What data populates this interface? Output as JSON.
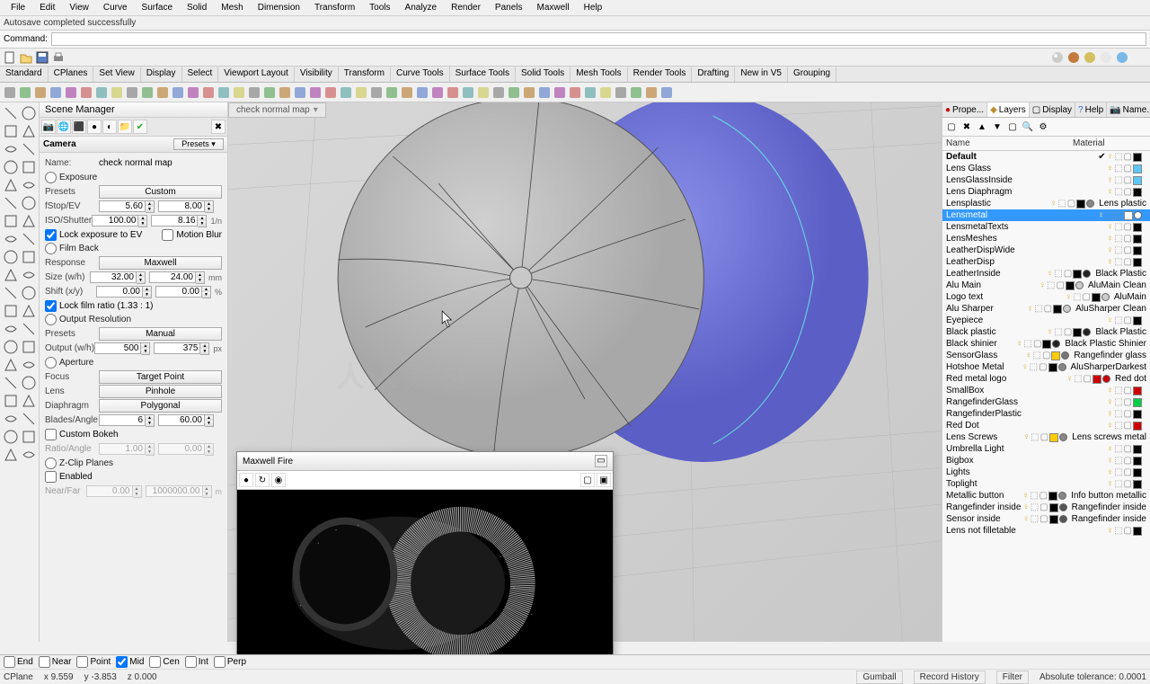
{
  "menu": [
    "File",
    "Edit",
    "View",
    "Curve",
    "Surface",
    "Solid",
    "Mesh",
    "Dimension",
    "Transform",
    "Tools",
    "Analyze",
    "Render",
    "Panels",
    "Maxwell",
    "Help"
  ],
  "autosave": "Autosave completed successfully",
  "command_label": "Command:",
  "tabstrip": [
    "Standard",
    "CPlanes",
    "Set View",
    "Display",
    "Select",
    "Viewport Layout",
    "Visibility",
    "Transform",
    "Curve Tools",
    "Surface Tools",
    "Solid Tools",
    "Mesh Tools",
    "Render Tools",
    "Drafting",
    "New in V5",
    "Grouping"
  ],
  "scene_mgr_title": "Scene Manager",
  "camera_label": "Camera",
  "presets_btn": "Presets ▾",
  "camera": {
    "name_label": "Name:",
    "name_value": "check normal map",
    "exposure": {
      "title": "Exposure",
      "presets_label": "Presets",
      "presets_btn": "Custom",
      "fstop_label": "fStop/EV",
      "fstop": "5.60",
      "ev": "8.00",
      "iso_label": "ISO/Shutter",
      "iso": "100.00",
      "shutter": "8.16",
      "shutter_unit": "1/n",
      "lock_exp": "Lock exposure to EV",
      "motion_blur": "Motion Blur"
    },
    "film": {
      "title": "Film Back",
      "response_label": "Response",
      "response_btn": "Maxwell",
      "size_label": "Size (w/h)",
      "size_w": "32.00",
      "size_h": "24.00",
      "size_unit": "mm",
      "shift_label": "Shift (x/y)",
      "shift_x": "0.00",
      "shift_y": "0.00",
      "shift_unit": "%",
      "lock_ratio": "Lock film ratio (1.33 : 1)"
    },
    "output": {
      "title": "Output Resolution",
      "presets_label": "Presets",
      "presets_btn": "Manual",
      "output_label": "Output (w/h)",
      "out_w": "500",
      "out_h": "375",
      "out_unit": "px"
    },
    "aperture": {
      "title": "Aperture",
      "focus_label": "Focus",
      "focus_btn": "Target Point",
      "lens_label": "Lens",
      "lens_btn": "Pinhole",
      "diaph_label": "Diaphragm",
      "diaph_btn": "Polygonal",
      "blades_label": "Blades/Angle",
      "blades": "6",
      "angle": "60.00",
      "bokeh": "Custom Bokeh",
      "ratio_label": "Ratio/Angle",
      "ratio": "1.00",
      "rangle": "0.00"
    },
    "zclip": {
      "title": "Z-Clip Planes",
      "enabled": "Enabled",
      "near_label": "Near/Far",
      "near": "0.00",
      "far": "1000000.00",
      "unit": "m"
    }
  },
  "viewport_title": "check normal map",
  "right_tabs": [
    {
      "icon": "●",
      "label": "Prope..."
    },
    {
      "icon": "◆",
      "label": "Layers"
    },
    {
      "icon": "▢",
      "label": "Display"
    },
    {
      "icon": "?",
      "label": "Help"
    },
    {
      "icon": "📷",
      "label": "Name..."
    }
  ],
  "layer_hdr": {
    "name": "Name",
    "material": "Material"
  },
  "layers": [
    {
      "name": "Default",
      "check": true,
      "color": "#000",
      "mat": ""
    },
    {
      "name": "Lens Glass",
      "color": "#5cc8f5",
      "mat": ""
    },
    {
      "name": "LensGlassInside",
      "color": "#5cc8f5",
      "mat": ""
    },
    {
      "name": "Lens Diaphragm",
      "color": "#000",
      "mat": ""
    },
    {
      "name": "Lensplastic",
      "color": "#000",
      "mat": "Lens plastic",
      "matdot": "#888"
    },
    {
      "name": "Lensmetal",
      "color": "#fff",
      "sel": true,
      "mat": "",
      "matdot": "#fff"
    },
    {
      "name": "LensmetalTexts",
      "color": "#000",
      "mat": ""
    },
    {
      "name": "LensMeshes",
      "color": "#000",
      "mat": ""
    },
    {
      "name": "LeatherDispWide",
      "color": "#000",
      "mat": ""
    },
    {
      "name": "LeatherDisp",
      "color": "#000",
      "mat": ""
    },
    {
      "name": "LeatherInside",
      "color": "#000",
      "mat": "Black Plastic",
      "matdot": "#222"
    },
    {
      "name": "Alu Main",
      "color": "#000",
      "mat": "AluMain Clean",
      "matdot": "#ccc"
    },
    {
      "name": "Logo text",
      "color": "#000",
      "mat": "AluMain",
      "matdot": "#ccc"
    },
    {
      "name": "Alu Sharper",
      "color": "#000",
      "mat": "AluSharper Clean",
      "matdot": "#ccc"
    },
    {
      "name": "Eyepiece",
      "color": "#000",
      "mat": ""
    },
    {
      "name": "Black plastic",
      "color": "#000",
      "mat": "Black Plastic",
      "matdot": "#222"
    },
    {
      "name": "Black shinier",
      "color": "#000",
      "mat": "Black Plastic Shinier",
      "matdot": "#222"
    },
    {
      "name": "SensorGlass",
      "color": "#ffcc00",
      "mat": "Rangefinder glass",
      "matdot": "#777"
    },
    {
      "name": "Hotshoe Metal",
      "color": "#000",
      "mat": "AluSharperDarkest",
      "matdot": "#888"
    },
    {
      "name": "Red metal logo",
      "color": "#cc0000",
      "mat": "Red dot",
      "matdot": "#cc0000"
    },
    {
      "name": "SmallBox",
      "color": "#cc0000",
      "mat": ""
    },
    {
      "name": "RangefinderGlass",
      "color": "#00cc44",
      "mat": ""
    },
    {
      "name": "RangefinderPlastic",
      "color": "#000",
      "mat": ""
    },
    {
      "name": "Red Dot",
      "color": "#cc0000",
      "mat": ""
    },
    {
      "name": "Lens Screws",
      "color": "#ffcc00",
      "mat": "Lens screws metal",
      "matdot": "#888"
    },
    {
      "name": "Umbrella Light",
      "color": "#000",
      "mat": ""
    },
    {
      "name": "Bigbox",
      "color": "#000",
      "mat": ""
    },
    {
      "name": "Lights",
      "color": "#000",
      "mat": ""
    },
    {
      "name": "Toplight",
      "color": "#000",
      "mat": ""
    },
    {
      "name": "Metallic button",
      "color": "#000",
      "mat": "Info button metallic",
      "matdot": "#888"
    },
    {
      "name": "Rangefinder inside",
      "color": "#000",
      "mat": "Rangefinder inside",
      "matdot": "#555"
    },
    {
      "name": "Sensor inside",
      "color": "#000",
      "mat": "Rangefinder inside",
      "matdot": "#555"
    },
    {
      "name": "Lens not filletable",
      "color": "#000",
      "mat": ""
    }
  ],
  "maxwell_title": "Maxwell Fire",
  "osnap": [
    {
      "label": "End",
      "chk": false
    },
    {
      "label": "Near",
      "chk": false
    },
    {
      "label": "Point",
      "chk": false
    },
    {
      "label": "Mid",
      "chk": true
    },
    {
      "label": "Cen",
      "chk": false
    },
    {
      "label": "Int",
      "chk": false
    },
    {
      "label": "Perp",
      "chk": false
    }
  ],
  "coords": {
    "cplane": "CPlane",
    "x": "x 9.559",
    "y": "y -3.853",
    "z": "z 0.000"
  },
  "status_right": {
    "gumball": "Gumball",
    "history": "Record History",
    "filter": "Filter",
    "tol": "Absolute tolerance: 0.0001"
  }
}
